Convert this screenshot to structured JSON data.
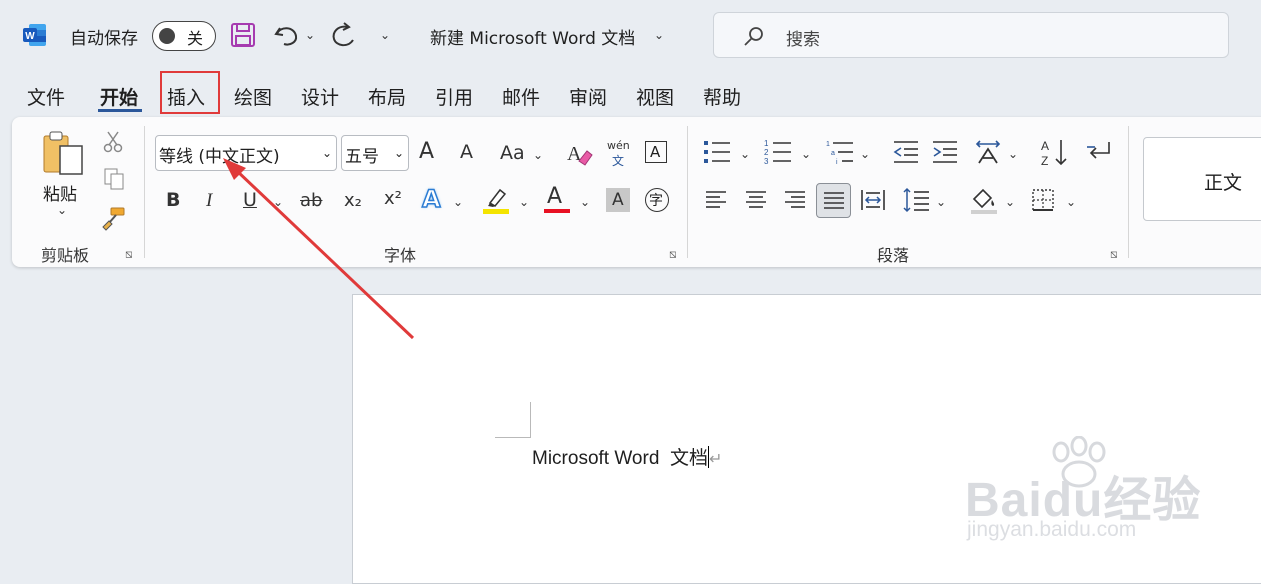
{
  "title_bar": {
    "autosave_label": "自动保存",
    "autosave_state": "关",
    "doc_title": "新建 Microsoft Word 文档",
    "search_placeholder": "搜索"
  },
  "tabs": [
    "文件",
    "开始",
    "插入",
    "绘图",
    "设计",
    "布局",
    "引用",
    "邮件",
    "审阅",
    "视图",
    "帮助"
  ],
  "ribbon": {
    "clipboard": {
      "paste_label": "粘贴",
      "group_label": "剪贴板"
    },
    "font": {
      "font_name": "等线 (中文正文)",
      "font_size": "五号",
      "group_label": "字体",
      "grow_glyph": "A",
      "shrink_glyph": "A",
      "case_glyph": "Aa",
      "phonetic_top": "wén",
      "phonetic_bottom": "文",
      "bold": "B",
      "italic": "I",
      "underline": "U",
      "strike": "ab",
      "subscript": "x₂",
      "superscript": "x²",
      "char_shade": "A",
      "enclose": "字",
      "effects": "A",
      "color_glyph": "A",
      "border_glyph": "A"
    },
    "paragraph": {
      "group_label": "段落"
    },
    "styles": {
      "normal": "正文"
    }
  },
  "document": {
    "text": "Microsoft Word  文档",
    "para_mark": "↵"
  },
  "watermark": {
    "logo": "Baidu经验",
    "sub": "jingyan.baidu.com"
  },
  "colors": {
    "accent": "#2b579a",
    "highlight_box": "#e03a3a",
    "arrow": "#e03a3a",
    "save_icon": "#a63bb0"
  }
}
